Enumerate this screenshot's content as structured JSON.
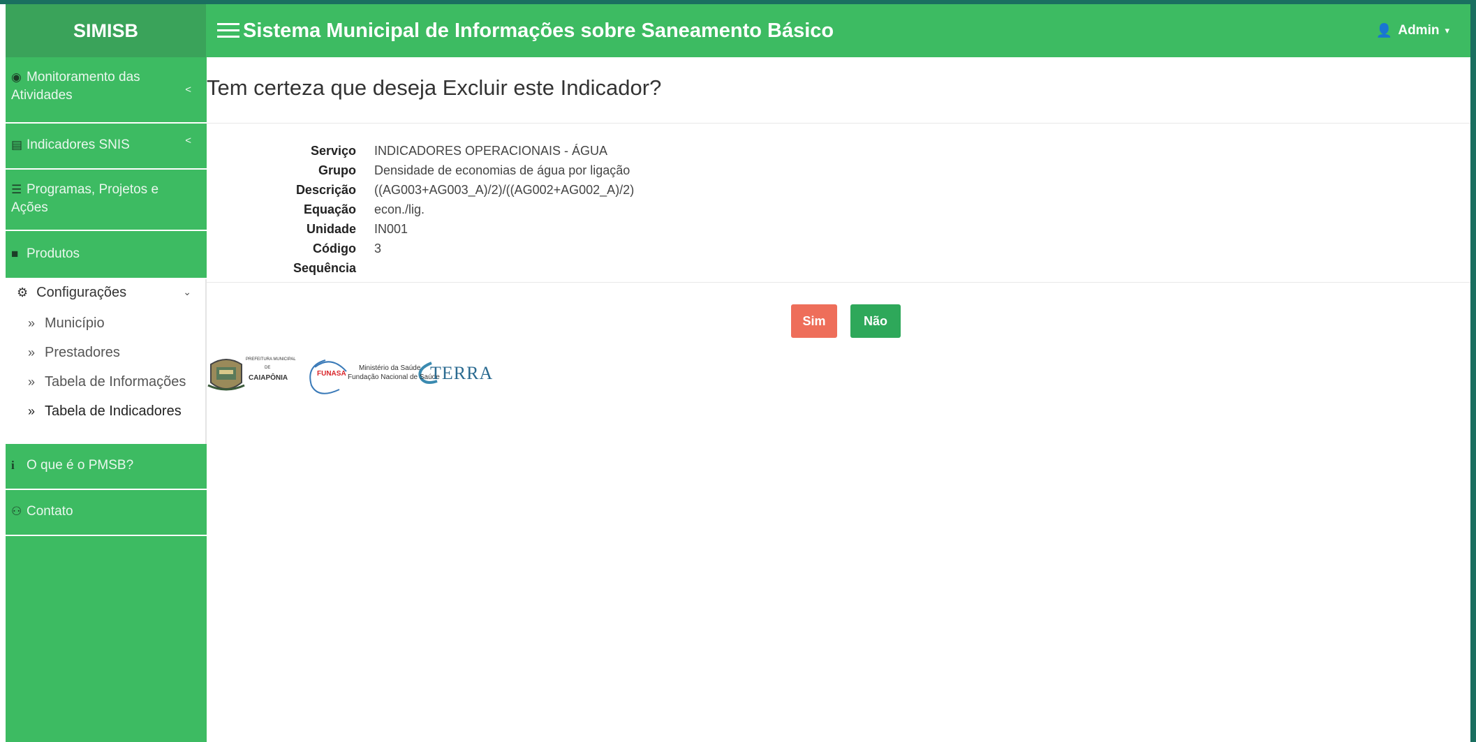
{
  "topbar": {
    "brand": "SIMISB",
    "title": "Sistema Municipal de Informações sobre Saneamento Básico",
    "user": "Admin"
  },
  "sidebar": {
    "items": [
      {
        "label_line1": "Monitoramento das",
        "label_line2": "Atividades",
        "icon": "dashboard-icon"
      },
      {
        "label": "Indicadores SNIS",
        "icon": "table-icon"
      },
      {
        "label_line1": "Programas, Projetos e",
        "label_line2": "Ações",
        "icon": "list-icon"
      },
      {
        "label": "Produtos",
        "icon": "folder-icon"
      },
      {
        "label": "Configurações",
        "icon": "gear-icon"
      },
      {
        "label": "O que é o PMSB?",
        "icon": "info-icon"
      },
      {
        "label": "Contato",
        "icon": "users-icon"
      }
    ],
    "submenu": [
      "Município",
      "Prestadores",
      "Tabela de Informações",
      "Tabela de Indicadores"
    ]
  },
  "main": {
    "title": "Tem certeza que deseja Excluir este Indicador?",
    "fields": [
      {
        "label": "Serviço",
        "value": "INDICADORES OPERACIONAIS  - ÁGUA"
      },
      {
        "label": "Grupo",
        "value": "Densidade de economias de água por ligação"
      },
      {
        "label": "Descrição",
        "value": "((AG003+AG003_A)/2)/((AG002+AG002_A)/2)"
      },
      {
        "label": "Equação",
        "value": "econ./lig."
      },
      {
        "label": "Unidade",
        "value": "IN001"
      },
      {
        "label": "Código",
        "value": "3"
      },
      {
        "label": "Sequência",
        "value": ""
      }
    ],
    "buttons": {
      "yes": "Sim",
      "no": "Não"
    }
  },
  "logos": {
    "prefeitura": {
      "line1": "PREFEITURA MUNICIPAL",
      "line2": "DE",
      "line3": "CAIAPÔNIA"
    },
    "funasa": {
      "mark": "FUNASA",
      "line1": "Ministério da Saúde",
      "line2": "Fundação Nacional de Saúde"
    },
    "terra": "TERRA"
  },
  "colors": {
    "green": "#3dbb62",
    "danger": "#ee6e5a",
    "success": "#2ea85a"
  }
}
